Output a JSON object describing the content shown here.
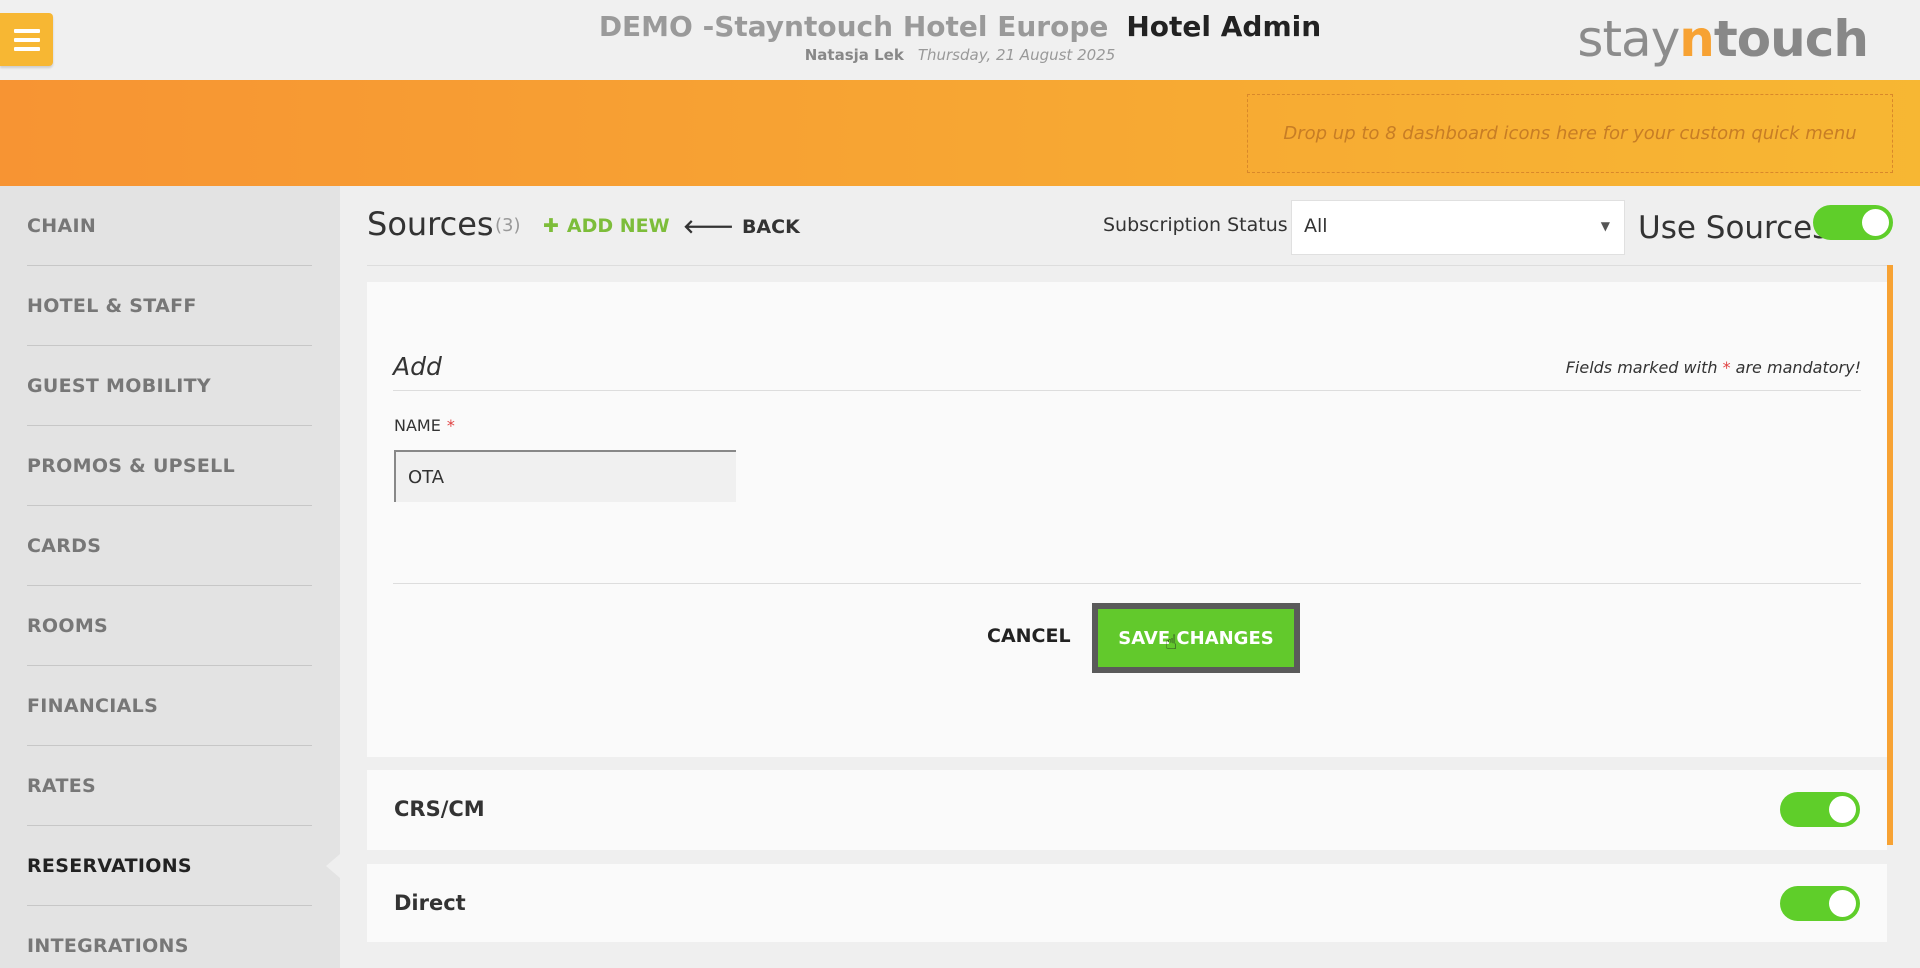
{
  "header": {
    "hotel_name": "DEMO -Stayntouch Hotel Europe",
    "admin_label": "Hotel Admin",
    "user_name": "Natasja Lek",
    "date": "Thursday, 21 August 2025",
    "logo": {
      "part1": "stay",
      "part2": "n",
      "part3": "touch"
    }
  },
  "quick_menu": {
    "placeholder": "Drop up to 8 dashboard icons here for your custom quick menu"
  },
  "sidebar": {
    "items": [
      {
        "label": "CHAIN"
      },
      {
        "label": "HOTEL & STAFF"
      },
      {
        "label": "GUEST MOBILITY"
      },
      {
        "label": "PROMOS & UPSELL"
      },
      {
        "label": "CARDS"
      },
      {
        "label": "ROOMS"
      },
      {
        "label": "FINANCIALS"
      },
      {
        "label": "RATES"
      },
      {
        "label": "RESERVATIONS",
        "active": true
      },
      {
        "label": "INTEGRATIONS"
      }
    ]
  },
  "page": {
    "title": "Sources",
    "count": "(3)",
    "add_new_label": "ADD NEW",
    "back_label": "BACK",
    "subscription_label": "Subscription Status",
    "subscription_value": "All",
    "use_sources_label": "Use Sources",
    "use_sources_on": true
  },
  "form": {
    "title": "Add",
    "mandatory_prefix": "Fields marked with",
    "mandatory_star": "*",
    "mandatory_suffix": "are mandatory!",
    "name_label": "NAME",
    "name_star": "*",
    "name_value": "OTA",
    "cancel_label": "CANCEL",
    "save_label": "SAVE CHANGES"
  },
  "sources": [
    {
      "name": "CRS/CM",
      "enabled": true
    },
    {
      "name": "Direct",
      "enabled": true
    }
  ],
  "colors": {
    "accent_orange": "#f7a233",
    "toggle_green": "#5fce2a",
    "save_green": "#62c92c",
    "add_new_green": "#7dbd3a"
  }
}
